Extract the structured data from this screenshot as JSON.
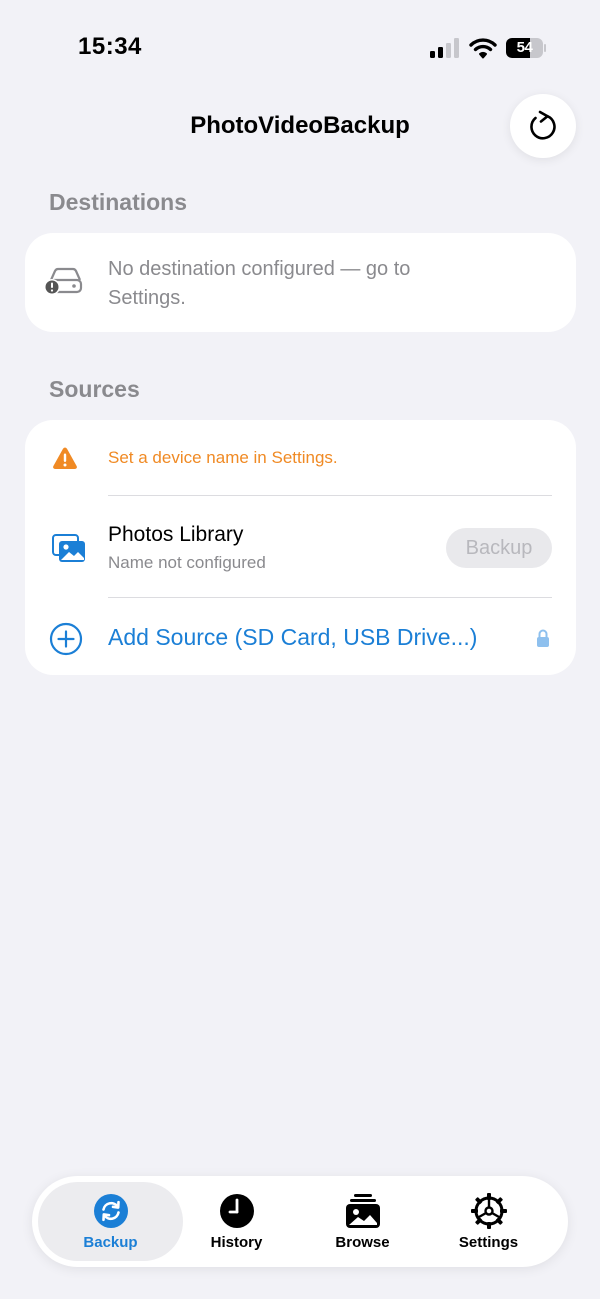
{
  "status_bar": {
    "time": "15:34",
    "battery_level": "54",
    "icons": [
      "cellular-signal-icon",
      "wifi-icon",
      "battery-icon"
    ]
  },
  "header": {
    "title": "PhotoVideoBackup",
    "refresh_icon": "refresh-icon"
  },
  "destinations": {
    "section_title": "Destinations",
    "icon": "external-drive-warning-icon",
    "empty_message": "No destination configured — go to Settings."
  },
  "sources": {
    "section_title": "Sources",
    "warning": {
      "icon": "warning-triangle-icon",
      "text": "Set a device name in Settings."
    },
    "photos_library": {
      "icon": "photo-stack-icon",
      "title": "Photos Library",
      "subtitle": "Name not configured",
      "button_label": "Backup",
      "button_enabled": false
    },
    "add_source": {
      "icon": "plus-circle-icon",
      "label": "Add Source (SD Card, USB Drive...)",
      "lock_icon": "lock-icon"
    }
  },
  "tab_bar": {
    "tabs": [
      {
        "label": "Backup",
        "icon": "sync-icon",
        "active": true
      },
      {
        "label": "History",
        "icon": "clock-icon",
        "active": false
      },
      {
        "label": "Browse",
        "icon": "photo-gallery-icon",
        "active": false
      },
      {
        "label": "Settings",
        "icon": "gear-icon",
        "active": false
      }
    ]
  },
  "colors": {
    "background": "#f2f2f7",
    "card": "#ffffff",
    "accent": "#1b7fd6",
    "warning": "#f08a24",
    "secondary_text": "#8a8a8e",
    "disabled_button_bg": "#e9e9ec",
    "disabled_button_text": "#b8b8bd"
  }
}
